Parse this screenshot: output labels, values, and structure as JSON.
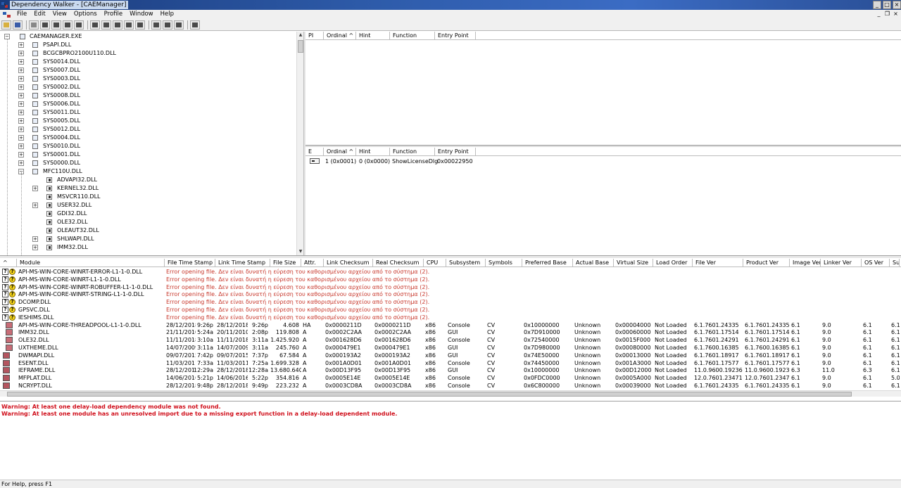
{
  "window": {
    "title": "Dependency Walker - [CAEManager]"
  },
  "menu": [
    "File",
    "Edit",
    "View",
    "Options",
    "Profile",
    "Window",
    "Help"
  ],
  "tree": {
    "root": "CAEMANAGER.EXE",
    "items": [
      {
        "label": "PSAPI.DLL",
        "level": 1,
        "expand": "+"
      },
      {
        "label": "BCGCBPRO2100U110.DLL",
        "level": 1,
        "expand": "+"
      },
      {
        "label": "SYS0014.DLL",
        "level": 1,
        "expand": "+"
      },
      {
        "label": "SYS0007.DLL",
        "level": 1,
        "expand": "+"
      },
      {
        "label": "SYS0003.DLL",
        "level": 1,
        "expand": "+"
      },
      {
        "label": "SYS0002.DLL",
        "level": 1,
        "expand": "+"
      },
      {
        "label": "SYS0008.DLL",
        "level": 1,
        "expand": "+"
      },
      {
        "label": "SYS0006.DLL",
        "level": 1,
        "expand": "+"
      },
      {
        "label": "SYS0011.DLL",
        "level": 1,
        "expand": "+"
      },
      {
        "label": "SYS0005.DLL",
        "level": 1,
        "expand": "+"
      },
      {
        "label": "SYS0012.DLL",
        "level": 1,
        "expand": "+"
      },
      {
        "label": "SYS0004.DLL",
        "level": 1,
        "expand": "+"
      },
      {
        "label": "SYS0010.DLL",
        "level": 1,
        "expand": "+"
      },
      {
        "label": "SYS0001.DLL",
        "level": 1,
        "expand": "+"
      },
      {
        "label": "SYS0000.DLL",
        "level": 1,
        "expand": "+"
      },
      {
        "label": "MFC110U.DLL",
        "level": 1,
        "expand": "-"
      },
      {
        "label": "ADVAPI32.DLL",
        "level": 2,
        "expand": ""
      },
      {
        "label": "KERNEL32.DLL",
        "level": 2,
        "expand": "+"
      },
      {
        "label": "MSVCR110.DLL",
        "level": 2,
        "expand": ""
      },
      {
        "label": "USER32.DLL",
        "level": 2,
        "expand": "+"
      },
      {
        "label": "GDI32.DLL",
        "level": 2,
        "expand": ""
      },
      {
        "label": "OLE32.DLL",
        "level": 2,
        "expand": ""
      },
      {
        "label": "OLEAUT32.DLL",
        "level": 2,
        "expand": ""
      },
      {
        "label": "SHLWAPI.DLL",
        "level": 2,
        "expand": "+"
      },
      {
        "label": "IMM32.DLL",
        "level": 2,
        "expand": "+"
      }
    ]
  },
  "imports": {
    "headers": [
      "PI",
      "Ordinal ^",
      "Hint",
      "Function",
      "Entry Point"
    ]
  },
  "exports": {
    "headers": [
      "E",
      "Ordinal ^",
      "Hint",
      "Function",
      "Entry Point"
    ],
    "rows": [
      {
        "ordinal": "1 (0x0001)",
        "hint": "0 (0x0000)",
        "function": "ShowLicenseDlg",
        "entry": "0x00022950"
      }
    ]
  },
  "modules": {
    "headers": [
      "^",
      "Module",
      "File Time Stamp",
      "Link Time Stamp",
      "File Size",
      "Attr.",
      "Link Checksum",
      "Real Checksum",
      "CPU",
      "Subsystem",
      "Symbols",
      "Preferred Base",
      "Actual Base",
      "Virtual Size",
      "Load Order",
      "File Ver",
      "Product Ver",
      "Image Ver",
      "Linker Ver",
      "OS Ver",
      "Su"
    ],
    "error_rows": [
      {
        "module": "API-MS-WIN-CORE-WINRT-ERROR-L1-1-0.DLL",
        "error": "Error opening file. Δεν είναι δυνατή η εύρεση του καθορισμένου αρχείου από το σύστημα (2)."
      },
      {
        "module": "API-MS-WIN-CORE-WINRT-L1-1-0.DLL",
        "error": "Error opening file. Δεν είναι δυνατή η εύρεση του καθορισμένου αρχείου από το σύστημα (2)."
      },
      {
        "module": "API-MS-WIN-CORE-WINRT-ROBUFFER-L1-1-0.DLL",
        "error": "Error opening file. Δεν είναι δυνατή η εύρεση του καθορισμένου αρχείου από το σύστημα (2)."
      },
      {
        "module": "API-MS-WIN-CORE-WINRT-STRING-L1-1-0.DLL",
        "error": "Error opening file. Δεν είναι δυνατή η εύρεση του καθορισμένου αρχείου από το σύστημα (2)."
      },
      {
        "module": "DCOMP.DLL",
        "error": "Error opening file. Δεν είναι δυνατή η εύρεση του καθορισμένου αρχείου από το σύστημα (2)."
      },
      {
        "module": "GPSVC.DLL",
        "error": "Error opening file. Δεν είναι δυνατή η εύρεση του καθορισμένου αρχείου από το σύστημα (2)."
      },
      {
        "module": "IESHIMS.DLL",
        "error": "Error opening file. Δεν είναι δυνατή η εύρεση του καθορισμένου αρχείου από το σύστημα (2)."
      }
    ],
    "rows": [
      [
        "API-MS-WIN-CORE-THREADPOOL-L1-1-0.DLL",
        "28/12/2018",
        "9:26p",
        "28/12/2018",
        "9:26p",
        "4.608",
        "HA",
        "0x0000211D",
        "0x0000211D",
        "x86",
        "Console",
        "CV",
        "0x10000000",
        "Unknown",
        "0x00004000",
        "Not Loaded",
        "6.1.7601.24335",
        "6.1.7601.24335",
        "6.1",
        "9.0",
        "6.1",
        "6.1"
      ],
      [
        "IMM32.DLL",
        "21/11/2010",
        "5:24a",
        "20/11/2010",
        "2:08p",
        "119.808",
        "A",
        "0x0002C2AA",
        "0x0002C2AA",
        "x86",
        "GUI",
        "CV",
        "0x7D910000",
        "Unknown",
        "0x00060000",
        "Not Loaded",
        "6.1.7601.17514",
        "6.1.7601.17514",
        "6.1",
        "9.0",
        "6.1",
        "6.1"
      ],
      [
        "OLE32.DLL",
        "11/11/2018",
        "3:10a",
        "11/11/2018",
        "3:11a",
        "1.425.920",
        "A",
        "0x001628D6",
        "0x001628D6",
        "x86",
        "Console",
        "CV",
        "0x72540000",
        "Unknown",
        "0x0015F000",
        "Not Loaded",
        "6.1.7601.24291",
        "6.1.7601.24291",
        "6.1",
        "9.0",
        "6.1",
        "6.1"
      ],
      [
        "UXTHEME.DLL",
        "14/07/2009",
        "3:11a",
        "14/07/2009",
        "3:11a",
        "245.760",
        "A",
        "0x000479E1",
        "0x000479E1",
        "x86",
        "GUI",
        "CV",
        "0x7D980000",
        "Unknown",
        "0x00080000",
        "Not Loaded",
        "6.1.7600.16385",
        "6.1.7600.16385",
        "6.1",
        "9.0",
        "6.1",
        "6.1"
      ],
      [
        "DWMAPI.DLL",
        "09/07/2015",
        "7:42p",
        "09/07/2015",
        "7:37p",
        "67.584",
        "A",
        "0x000193A2",
        "0x000193A2",
        "x86",
        "GUI",
        "CV",
        "0x74E50000",
        "Unknown",
        "0x00013000",
        "Not Loaded",
        "6.1.7601.18917",
        "6.1.7601.18917",
        "6.1",
        "9.0",
        "6.1",
        "6.1"
      ],
      [
        "ESENT.DLL",
        "11/03/2011",
        "7:33a",
        "11/03/2011",
        "7:25a",
        "1.699.328",
        "A",
        "0x001A0D01",
        "0x001A0D01",
        "x86",
        "Console",
        "CV",
        "0x74450000",
        "Unknown",
        "0x001A3000",
        "Not Loaded",
        "6.1.7601.17577",
        "6.1.7601.17577",
        "6.1",
        "9.0",
        "6.1",
        "6.1"
      ],
      [
        "IEFRAME.DLL",
        "28/12/2018",
        "12:29a",
        "28/12/2018",
        "12:28a",
        "13.680.640",
        "A",
        "0x00D13F95",
        "0x00D13F95",
        "x86",
        "GUI",
        "CV",
        "0x10000000",
        "Unknown",
        "0x00D12000",
        "Not Loaded",
        "11.0.9600.19236",
        "11.0.9600.19236",
        "6.3",
        "11.0",
        "6.3",
        "6.1"
      ],
      [
        "MFPLAT.DLL",
        "14/06/2016",
        "5:21p",
        "14/06/2016",
        "5:22p",
        "354.816",
        "A",
        "0x0005E14E",
        "0x0005E14E",
        "x86",
        "Console",
        "CV",
        "0x0FDC0000",
        "Unknown",
        "0x0005A000",
        "Not Loaded",
        "12.0.7601.23471",
        "12.0.7601.23471",
        "6.1",
        "9.0",
        "6.1",
        "5.0"
      ],
      [
        "NCRYPT.DLL",
        "28/12/2018",
        "9:48p",
        "28/12/2018",
        "9:49p",
        "223.232",
        "A",
        "0x0003CD8A",
        "0x0003CD8A",
        "x86",
        "Console",
        "CV",
        "0x6C800000",
        "Unknown",
        "0x00039000",
        "Not Loaded",
        "6.1.7601.24335",
        "6.1.7601.24335",
        "6.1",
        "9.0",
        "6.1",
        "6.1"
      ]
    ]
  },
  "log": [
    "Warning: At least one delay-load dependency module was not found.",
    "Warning: At least one module has an unresolved import due to a missing export function in a delay-load dependent module."
  ],
  "status": "For Help, press F1"
}
